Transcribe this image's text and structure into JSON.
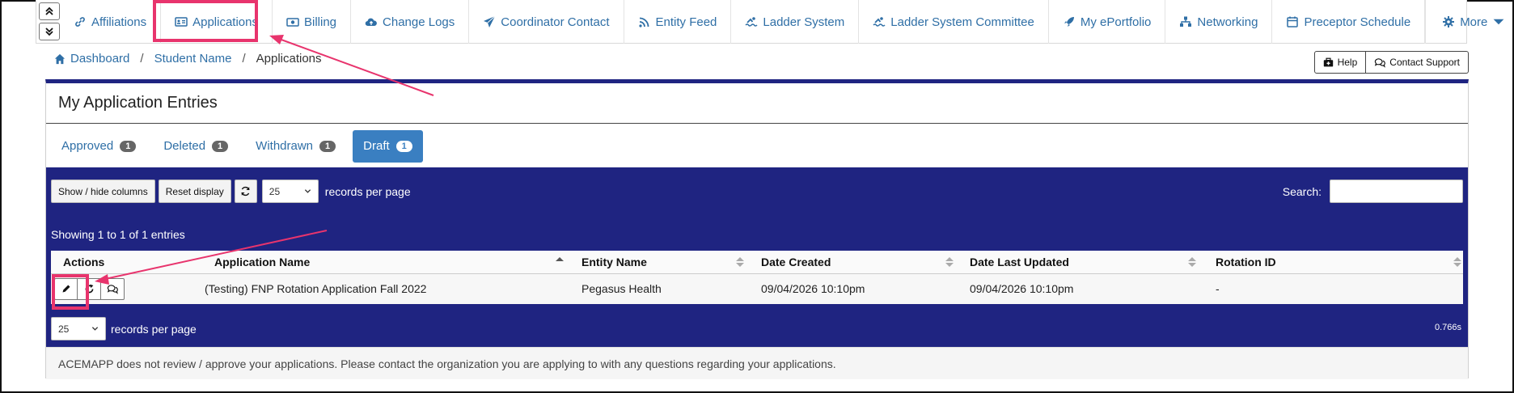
{
  "nav": {
    "items": [
      {
        "label": "Affiliations",
        "icon": "link-icon"
      },
      {
        "label": "Applications",
        "icon": "id-card-icon"
      },
      {
        "label": "Billing",
        "icon": "money-bill-icon"
      },
      {
        "label": "Change Logs",
        "icon": "cloud-upload-icon"
      },
      {
        "label": "Coordinator Contact",
        "icon": "paper-plane-icon"
      },
      {
        "label": "Entity Feed",
        "icon": "rss-icon"
      },
      {
        "label": "Ladder System",
        "icon": "swimmer-icon"
      },
      {
        "label": "Ladder System Committee",
        "icon": "swimmer-icon"
      },
      {
        "label": "My ePortfolio",
        "icon": "rocket-icon"
      },
      {
        "label": "Networking",
        "icon": "network-icon"
      },
      {
        "label": "Preceptor Schedule",
        "icon": "calendar-icon"
      }
    ],
    "more_label": "More"
  },
  "breadcrumb": {
    "home": "Dashboard",
    "student": "Student Name",
    "current": "Applications"
  },
  "help": {
    "help_label": "Help",
    "support_label": "Contact Support"
  },
  "panel": {
    "title": "My Application Entries",
    "tabs": [
      {
        "label": "Approved",
        "count": "1"
      },
      {
        "label": "Deleted",
        "count": "1"
      },
      {
        "label": "Withdrawn",
        "count": "1"
      },
      {
        "label": "Draft",
        "count": "1"
      }
    ]
  },
  "table": {
    "show_hide_label": "Show / hide columns",
    "reset_label": "Reset display",
    "per_page_value": "25",
    "per_page_text": "records per page",
    "search_label": "Search:",
    "showing": "Showing 1 to 1 of 1 entries",
    "columns": [
      "Actions",
      "Application Name",
      "Entity Name",
      "Date Created",
      "Date Last Updated",
      "Rotation ID"
    ],
    "rows": [
      {
        "application_name": "(Testing) FNP Rotation Application Fall 2022",
        "entity_name": "Pegasus Health",
        "date_created": "09/04/2026 10:10pm",
        "date_last_updated": "09/04/2026 10:10pm",
        "rotation_id": "-"
      }
    ],
    "timing": "0.766s"
  },
  "footer_note": "ACEMAPP does not review / approve your applications. Please contact the organization you are applying to with any questions regarding your applications.",
  "colors": {
    "primary_navy": "#1f2481",
    "link_blue": "#2f6fa6",
    "highlight": "#e8346d",
    "tab_active": "#3a7fc1"
  }
}
